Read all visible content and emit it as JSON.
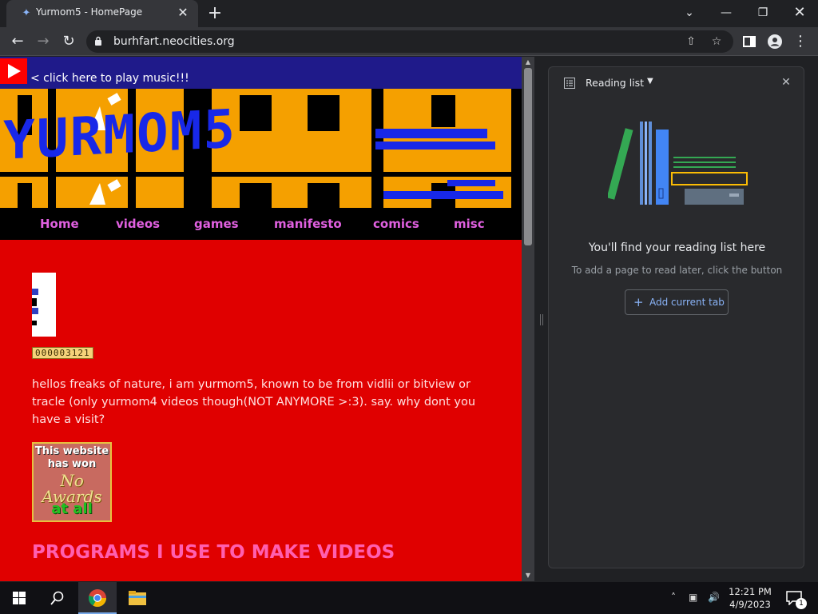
{
  "browser": {
    "tab_title": "Yurmom5 - HomePage",
    "tab_favicon": "blue-bird-favicon",
    "new_tab_label": "+",
    "url": "burhfart.neocities.org"
  },
  "page": {
    "music_link": "< click here to play music!!!",
    "banner_text": "YURMOM5",
    "nav": [
      "Home",
      "videos",
      "games",
      "manifesto",
      "comics",
      "misc"
    ],
    "counter": "000003121",
    "intro": "hellos freaks of nature, i am yurmom5, known to be from vidlii or bitview or tracle (only yurmom4 videos though(NOT ANYMORE >:3). say. why dont you have a visit?",
    "award": {
      "line1": "This website has won",
      "line2": "No Awards",
      "line3": "at all"
    },
    "section_heading": "PROGRAMS I USE TO MAKE VIDEOS",
    "colors": {
      "background": "#e00000",
      "music_bar": "#1f1a8a",
      "nav_text": "#e060e0",
      "heading": "#ff5fb0"
    }
  },
  "reading_list": {
    "title": "Reading list",
    "empty_title": "You'll find your reading list here",
    "empty_subtitle": "To add a page to read later, click the button",
    "add_button": "Add current tab"
  },
  "taskbar": {
    "time": "12:21 PM",
    "date": "4/9/2023",
    "notification_count": "1"
  }
}
